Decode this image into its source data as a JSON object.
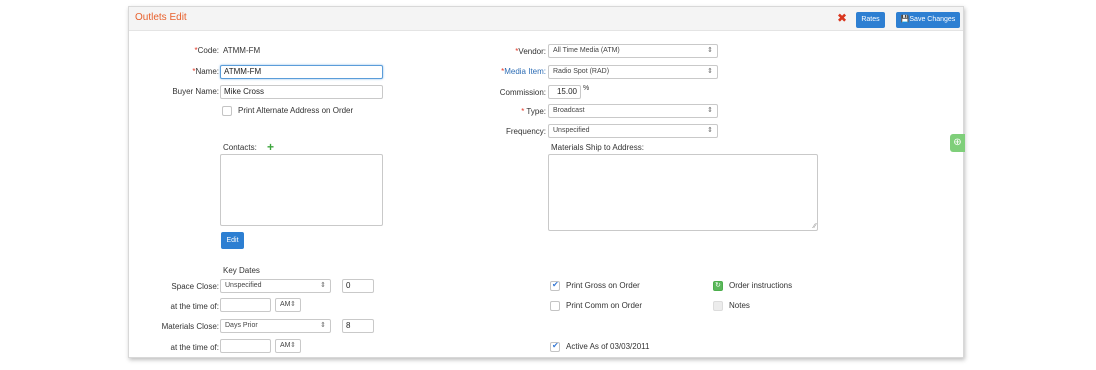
{
  "header": {
    "title": "Outlets Edit",
    "close_glyph": "✖",
    "rates_label": "Rates",
    "save_label": "Save Changes",
    "save_icon": "floppy-disk-icon"
  },
  "left": {
    "code": {
      "label": "Code:",
      "value": "ATMM-FM"
    },
    "name": {
      "label": "Name:",
      "value": "ATMM-FM"
    },
    "buyer_name": {
      "label": "Buyer Name:",
      "value": "Mike Cross"
    },
    "print_alt_address": {
      "label": "Print Alternate Address on Order",
      "checked": false
    },
    "contacts": {
      "label": "Contacts:"
    },
    "edit_label": "Edit",
    "key_dates": {
      "heading": "Key Dates",
      "space_close": {
        "label": "Space Close:",
        "select": "Unspecified",
        "number": "0"
      },
      "space_time": {
        "label": "at the time of:",
        "time": "",
        "ampm": "AM"
      },
      "materials_close": {
        "label": "Materials Close:",
        "select": "Days Prior",
        "number": "8"
      },
      "materials_time": {
        "label": "at the time of:",
        "time": "",
        "ampm": "AM"
      }
    }
  },
  "right": {
    "vendor": {
      "label": "Vendor:",
      "value": "All Time Media (ATM)"
    },
    "media_item": {
      "label": "Media Item:",
      "value": "Radio Spot (RAD)"
    },
    "commission": {
      "label": "Commission:",
      "value": "15.00",
      "unit": "%"
    },
    "type": {
      "label": "Type:",
      "value": "Broadcast"
    },
    "frequency": {
      "label": "Frequency:",
      "value": "Unspecified"
    },
    "materials_ship": {
      "label": "Materials Ship to Address:"
    },
    "print_gross": {
      "label": "Print Gross on Order",
      "checked": true
    },
    "print_comm": {
      "label": "Print Comm on Order",
      "checked": false
    },
    "active_as_of": {
      "label": "Active As of 03/03/2011",
      "checked": true
    },
    "order_instructions": {
      "label": "Order instructions",
      "state": "active"
    },
    "notes": {
      "label": "Notes",
      "state": "inactive"
    }
  },
  "required_mark": "*",
  "select_arrow": "⇕",
  "side_tab_glyph": "⊕",
  "colors": {
    "accent": "#2d7fd2",
    "title": "#e8602c",
    "required": "#e23b2a",
    "side_tab": "#7fcf7a"
  }
}
